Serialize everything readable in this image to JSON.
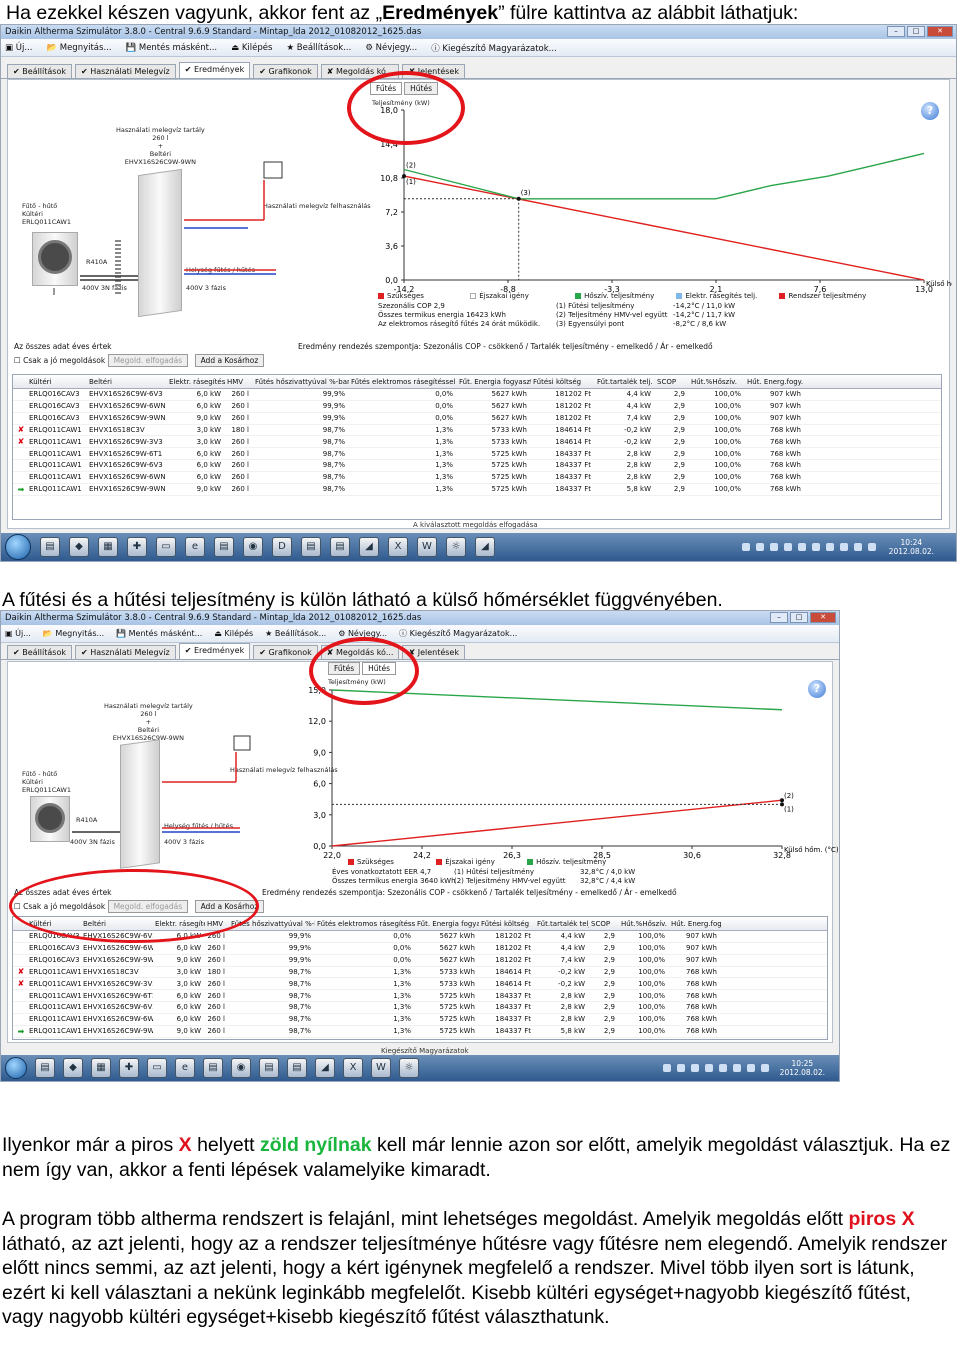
{
  "intro": {
    "before": "Ha ezekkel készen vagyunk, akkor fent az „",
    "bold": "Eredmények",
    "after": "” fülre kattintva az alábbit láthatjuk:"
  },
  "caption2": "A fűtési és a hűtési teljesítmény is külön látható a külső hőmérséklet függvényében.",
  "para1": {
    "t1": "Ilyenkor már a piros ",
    "x": "X",
    "t2": " helyett ",
    "green": "zöld nyílnak",
    "t3": " kell már lennie azon sor előtt, amelyik megoldást választjuk. Ha ez nem így van, akkor a fenti lépések valamelyike kimaradt."
  },
  "para2": {
    "t1": "A program több altherma rendszert is felajánl, mint lehetséges megoldást. Amelyik megoldás előtt ",
    "red": "piros X",
    "t2": " látható, az azt jelenti, hogy az a rendszer teljesítménye hűtésre vagy fűtésre nem elegendő. Amelyik rendszer előtt nincs semmi, az azt jelenti, hogy a kért igénynek megfelelő a rendszer. Mivel több ilyen sort is látunk, ezért ki kell választani a nekünk leginkább megfelelőt. Kisebb kültéri egységet+nagyobb kiegészítő fűtést, vagy nagyobb kültéri egységet+kisebb kiegészítő fűtést választhatunk."
  },
  "app": {
    "title": "Daikin Altherma Szimulátor 3.8.0 - Central 9.6.9 Standard - Mintap_lda 2012_01082012_1625.das",
    "toolbar": [
      "Új...",
      "Megnyitás...",
      "Mentés másként...",
      "Kilépés",
      "Beállítások...",
      "Névjegy...",
      "Kiegészítő Magyarázatok..."
    ],
    "tabs": [
      "Beállítások",
      "Használati Melegvíz",
      "Eredmények",
      "Grafikonok",
      "Megoldás kó...",
      "Jelentések"
    ],
    "subtabs": [
      "Fűtés",
      "Hűtés"
    ],
    "schematic": {
      "tank_label": "Használati melegvíz tartály\n260 l\n+\nBeltéri\nEHVX16S26C9W-9WN",
      "outdoor_label": "Fűtő - hűtő\nKültéri\nERLQ011CAW1",
      "refrigerant": "R410A",
      "power1": "400V 3N fázis",
      "power2": "400V 3 fázis",
      "consumer": "Használati melegvíz felhasználás",
      "heating": "Helység fűtés / hűtés"
    },
    "legend_heat": {
      "l1": "Szükséges",
      "l2": "Éjszakai igény",
      "l3": "Hőszív. teljesítmény",
      "l4": "Elektr. rásegítés telj.",
      "l5": "Rendszer teljesítmény",
      "s1": "Szezonális COP  2,9",
      "s2": "Összes termikus energia  16423 kWh",
      "s3": "Az elektromos rásegítő fűtés 24 órát működik.",
      "p1": "(1) Fűtési teljesítmény",
      "p1v": "-14,2°C / 11,0 kW",
      "p2": "(2) Teljesítmény HMV-vel együtt",
      "p2v": "-14,2°C / 11,7 kW",
      "p3": "(3) Egyensúlyi pont",
      "p3v": "-8,2°C / 8,6 kW"
    },
    "legend_cool": {
      "l1": "Szükséges",
      "l2": "Éjszakai igény",
      "l3": "Hőszív. teljesítmény",
      "s1": "Éves vonatkoztatott EER  4,7",
      "s2": "Összes termikus energia  3640 kWh",
      "p1": "(1) Hűtési teljesítmény",
      "p1v": "32,8°C / 4,0 kW",
      "p2": "(2) Teljesítmény HMV-vel együtt",
      "p2v": "32,8°C / 4,4 kW"
    },
    "options": {
      "all": "Az összes adat éves értek",
      "only": "Csak a jó megoldások",
      "accept": "Megold. elfogadás",
      "cart": "Add a Kosárhoz",
      "sort": "Eredmény rendezés szempontja: Szezonális COP - csökkenő / Tartalék teljesítmény - emelkedő / Ár - emelkedő"
    },
    "table": {
      "headers": [
        "Kültéri",
        "Beltéri",
        "Elektr. rásegítés",
        "HMV",
        "Fűtés hőszivattyúval %-ban",
        "Fűtés elektromos rásegítéssel %-ban",
        "Fűt. Energia fogyasztás",
        "Fűtési költség",
        "Fűt.tartalék telj.",
        "SCOP",
        "Hűt.%Hőszív.",
        "Hűt. Energ.fogy."
      ],
      "rows": [
        [
          "",
          "ERLQ016CAV3",
          "EHVX16S26C9W-6V3",
          "6,0 kW",
          "260 l",
          "99,9%",
          "0,0%",
          "5627 kWh",
          "181202 Ft",
          "4,4 kW",
          "2,9",
          "100,0%",
          "907 kWh"
        ],
        [
          "",
          "ERLQ016CAV3",
          "EHVX16S26C9W-6WN",
          "6,0 kW",
          "260 l",
          "99,9%",
          "0,0%",
          "5627 kWh",
          "181202 Ft",
          "4,4 kW",
          "2,9",
          "100,0%",
          "907 kWh"
        ],
        [
          "",
          "ERLQ016CAV3",
          "EHVX16S26C9W-9WN",
          "9,0 kW",
          "260 l",
          "99,9%",
          "0,0%",
          "5627 kWh",
          "181202 Ft",
          "7,4 kW",
          "2,9",
          "100,0%",
          "907 kWh"
        ],
        [
          "x",
          "ERLQ011CAW1",
          "EHVX16S18C3V",
          "3,0 kW",
          "180 l",
          "98,7%",
          "1,3%",
          "5733 kWh",
          "184614 Ft",
          "-0,2 kW",
          "2,9",
          "100,0%",
          "768 kWh"
        ],
        [
          "x",
          "ERLQ011CAW1",
          "EHVX16S26C9W-3V3",
          "3,0 kW",
          "260 l",
          "98,7%",
          "1,3%",
          "5733 kWh",
          "184614 Ft",
          "-0,2 kW",
          "2,9",
          "100,0%",
          "768 kWh"
        ],
        [
          "",
          "ERLQ011CAW1",
          "EHVX16S26C9W-6T1",
          "6,0 kW",
          "260 l",
          "98,7%",
          "1,3%",
          "5725 kWh",
          "184337 Ft",
          "2,8 kW",
          "2,9",
          "100,0%",
          "768 kWh"
        ],
        [
          "",
          "ERLQ011CAW1",
          "EHVX16S26C9W-6V3",
          "6,0 kW",
          "260 l",
          "98,7%",
          "1,3%",
          "5725 kWh",
          "184337 Ft",
          "2,8 kW",
          "2,9",
          "100,0%",
          "768 kWh"
        ],
        [
          "",
          "ERLQ011CAW1",
          "EHVX16S26C9W-6WN",
          "6,0 kW",
          "260 l",
          "98,7%",
          "1,3%",
          "5725 kWh",
          "184337 Ft",
          "2,8 kW",
          "2,9",
          "100,0%",
          "768 kWh"
        ],
        [
          "arrow",
          "ERLQ011CAW1",
          "EHVX16S26C9W-9WN",
          "9,0 kW",
          "260 l",
          "98,7%",
          "1,3%",
          "5725 kWh",
          "184337 Ft",
          "5,8 kW",
          "2,9",
          "100,0%",
          "768 kWh"
        ]
      ]
    },
    "status1": "A kiválasztott megoldás elfogadása",
    "status2": "Kiegészítő Magyarázatok",
    "clock1": {
      "time": "10:24",
      "date": "2012.08.02."
    },
    "clock2": {
      "time": "10:25",
      "date": "2012.08.02."
    }
  },
  "chart_data": [
    {
      "type": "line",
      "title": "",
      "ylabel": "Teljesítmény (kW)",
      "xlabel": "Külső hőm. (°C)",
      "yticks": [
        "18,0",
        "14,4",
        "10,8",
        "7,2",
        "3,6",
        "0,0"
      ],
      "xticks": [
        "-14,2",
        "-8,8",
        "-3,3",
        "2,1",
        "7,6",
        "13,0"
      ],
      "xlim": [
        -14.2,
        13.0
      ],
      "ylim": [
        0,
        18
      ],
      "series": [
        {
          "name": "Szükséges",
          "color": "#e02020",
          "x": [
            -14.2,
            13.0
          ],
          "y": [
            11.0,
            0.0
          ]
        },
        {
          "name": "Hőszív. teljesítmény",
          "color": "#2aa64a",
          "x": [
            -14.2,
            -8.2,
            -2.0,
            2.1,
            5.0,
            8.0,
            10.5,
            13.0
          ],
          "y": [
            11.7,
            8.6,
            8.6,
            8.6,
            10.0,
            11.0,
            12.2,
            13.4
          ]
        }
      ],
      "annotations": [
        "(1)",
        "(2)",
        "(3)"
      ]
    },
    {
      "type": "line",
      "title": "",
      "ylabel": "Teljesítmény (kW)",
      "xlabel": "Külső hőm. (°C)",
      "yticks": [
        "15,0",
        "12,0",
        "9,0",
        "6,0",
        "3,0",
        "0,0"
      ],
      "xticks": [
        "22,0",
        "24,2",
        "26,3",
        "28,5",
        "30,6",
        "32,8"
      ],
      "xlim": [
        22.0,
        32.8
      ],
      "ylim": [
        0,
        15
      ],
      "series": [
        {
          "name": "Szükséges",
          "color": "#e02020",
          "x": [
            22.0,
            32.8
          ],
          "y": [
            0.0,
            4.4
          ]
        },
        {
          "name": "Hőszív. teljesítmény",
          "color": "#2aa64a",
          "x": [
            22.0,
            32.8
          ],
          "y": [
            15.0,
            13.1
          ]
        }
      ],
      "annotations": [
        "(1)",
        "(2)"
      ]
    }
  ]
}
